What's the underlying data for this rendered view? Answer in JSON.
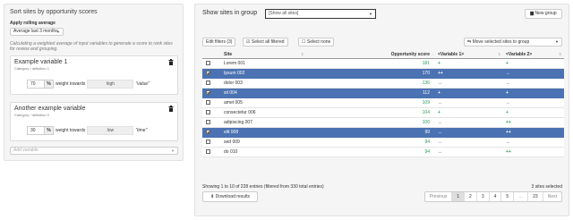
{
  "left": {
    "title": "Sort sites by opportunity scores",
    "rolling_label": "Apply rolling average",
    "rolling_value": "Average last 3 months",
    "description": "Calculating a weighted average of input variables to generate a score to rank sites for review and grouping.",
    "variables": [
      {
        "name": "Example variable 1",
        "category": "Category / definition 1",
        "weight": "70",
        "weight_unit": "%",
        "weight_text": "weight towards",
        "direction": "high",
        "value_text": "\"value\""
      },
      {
        "name": "Another example variable",
        "category": "Category / definition 2",
        "weight": "30",
        "weight_unit": "%",
        "weight_text": "weight towards",
        "direction": "low",
        "value_text": "\"time\""
      }
    ],
    "add_placeholder": "Add variable"
  },
  "right": {
    "title": "Show sites in group",
    "group_value": "[Show all sites]",
    "new_group_label": "New group",
    "toolbar": {
      "edit_filters": "Edit filters (3)",
      "select_all": "Select all filtered",
      "select_none": "Select none",
      "move_selected": "Move selected sites to group"
    },
    "columns": [
      "Site",
      "Opportunity score",
      "<Variable 1>",
      "<Variable 2>"
    ],
    "rows": [
      {
        "site": "Lorem 001",
        "score": "181",
        "v1": "+",
        "v2": "+",
        "selected": false
      },
      {
        "site": "Ipsum 002",
        "score": "170",
        "v1": "++",
        "v2": "↔",
        "selected": true
      },
      {
        "site": "dolor 003",
        "score": "136",
        "v1": "↔",
        "v2": "↔",
        "selected": false
      },
      {
        "site": "sit 004",
        "score": "112",
        "v1": "+",
        "v2": "+",
        "selected": true
      },
      {
        "site": "amet 005",
        "score": "109",
        "v1": "↔",
        "v2": "↔",
        "selected": false
      },
      {
        "site": "consectetur 006",
        "score": "104",
        "v1": "+",
        "v2": "+",
        "selected": false
      },
      {
        "site": "adipiscing 007",
        "score": "100",
        "v1": "↔",
        "v2": "++",
        "selected": false
      },
      {
        "site": "elit 008",
        "score": "99",
        "v1": "↔",
        "v2": "++",
        "selected": true
      },
      {
        "site": "sed 009",
        "score": "94",
        "v1": "↔",
        "v2": "↔",
        "selected": false
      },
      {
        "site": "do 010",
        "score": "94",
        "v1": "↔",
        "v2": "++",
        "selected": false
      }
    ],
    "footer_left": "Showing 1 to 10 of 228 entries (filtered from 330 total entries)",
    "footer_right": "3 sites selected",
    "download_label": "Download results",
    "pagination": [
      "Previous",
      "1",
      "2",
      "3",
      "4",
      "5",
      "…",
      "23",
      "Next"
    ]
  },
  "colors": {
    "selected_row": "#4b72b2",
    "positive": "#2a9a5a"
  },
  "icons": [
    "caret-down-icon",
    "trash-icon",
    "folder-plus-icon",
    "check-square-icon",
    "square-icon",
    "filter-icon",
    "sort-icon",
    "download-icon",
    "move-icon"
  ]
}
